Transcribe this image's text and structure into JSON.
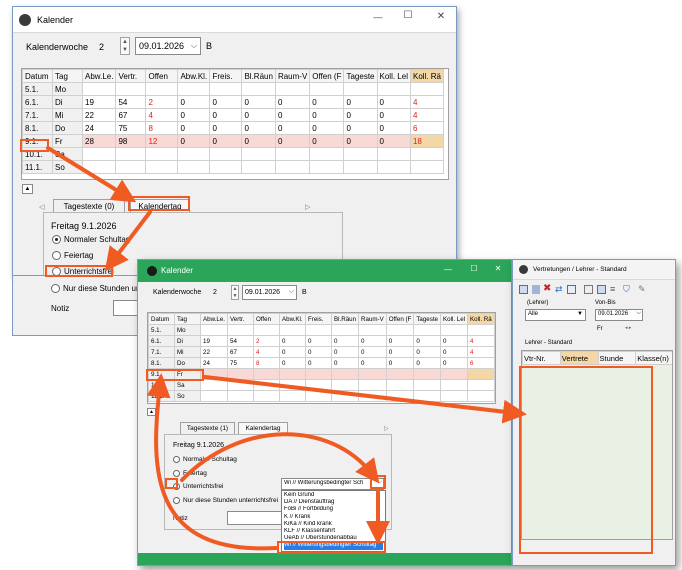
{
  "colors": {
    "accent": "#f05a23",
    "selection_row": "#f8d9d6",
    "koll_column": "#f3d7a6",
    "red_value": "#e02020",
    "list_selection": "#2a7ce0"
  },
  "window_back": {
    "title": "Kalender",
    "week_label": "Kalenderwoche",
    "week_number": "2",
    "date_value": "09.01.2026",
    "b_label": "B",
    "grid": {
      "columns": [
        "Datum",
        "Tag",
        "Abw.Le.",
        "Vertr.",
        "Offen",
        "Abw.Kl.",
        "Freis.",
        "Bl.Räun",
        "Raum-V",
        "Offen (F",
        "Tageste",
        "Koll. Lel",
        "Koll. Rä"
      ],
      "rows": [
        [
          "5.1.",
          "Mo",
          "",
          "",
          "",
          "",
          "",
          "",
          "",
          "",
          "",
          "",
          ""
        ],
        [
          "6.1.",
          "Di",
          "19",
          "54",
          "2",
          "0",
          "0",
          "0",
          "0",
          "0",
          "0",
          "0",
          "4"
        ],
        [
          "7.1.",
          "Mi",
          "22",
          "67",
          "4",
          "0",
          "0",
          "0",
          "0",
          "0",
          "0",
          "0",
          "4"
        ],
        [
          "8.1.",
          "Do",
          "24",
          "75",
          "8",
          "0",
          "0",
          "0",
          "0",
          "0",
          "0",
          "0",
          "6"
        ],
        [
          "9.1.",
          "Fr",
          "28",
          "98",
          "12",
          "0",
          "0",
          "0",
          "0",
          "0",
          "0",
          "0",
          "18"
        ],
        [
          "10.1.",
          "Sa",
          "",
          "",
          "",
          "",
          "",
          "",
          "",
          "",
          "",
          "",
          ""
        ],
        [
          "11.1.",
          "So",
          "",
          "",
          "",
          "",
          "",
          "",
          "",
          "",
          "",
          "",
          ""
        ]
      ]
    },
    "tab_tagestexte": "Tagestexte (0)",
    "tab_kalendertag": "Kalendertag",
    "day_heading": "Freitag 9.1.2026",
    "radio_normal": "Normaler Schultag",
    "radio_feiertag": "Feiertag",
    "radio_unterrichtsfrei": "Unterrichtsfrei",
    "radio_nur_stunden": "Nur diese Stunden unt",
    "notiz_label": "Notiz",
    "collapse_glyph": "▲"
  },
  "window_front": {
    "title": "Kalender",
    "week_label": "Kalenderwoche",
    "week_number": "2",
    "date_value": "09.01.2026",
    "b_label": "B",
    "grid": {
      "columns": [
        "Datum",
        "Tag",
        "Abw.Le.",
        "Vertr.",
        "Offen",
        "Abw.Kl.",
        "Freis.",
        "Bl.Räun",
        "Raum-V",
        "Offen (F",
        "Tageste",
        "Koll. Lel",
        "Koll. Rä"
      ],
      "rows": [
        [
          "5.1.",
          "Mo",
          "",
          "",
          "",
          "",
          "",
          "",
          "",
          "",
          "",
          "",
          ""
        ],
        [
          "6.1.",
          "Di",
          "19",
          "54",
          "2",
          "0",
          "0",
          "0",
          "0",
          "0",
          "0",
          "0",
          "4"
        ],
        [
          "7.1.",
          "Mi",
          "22",
          "67",
          "4",
          "0",
          "0",
          "0",
          "0",
          "0",
          "0",
          "0",
          "4"
        ],
        [
          "8.1.",
          "Do",
          "24",
          "75",
          "8",
          "0",
          "0",
          "0",
          "0",
          "0",
          "0",
          "0",
          "6"
        ],
        [
          "9.1.",
          "Fr",
          "",
          "",
          "",
          "",
          "",
          "",
          "",
          "",
          "",
          "",
          ""
        ],
        [
          "10.1.",
          "Sa",
          "",
          "",
          "",
          "",
          "",
          "",
          "",
          "",
          "",
          "",
          ""
        ],
        [
          "11.1.",
          "So",
          "",
          "",
          "",
          "",
          "",
          "",
          "",
          "",
          "",
          "",
          ""
        ]
      ]
    },
    "tab_tagestexte": "Tagestexte (1)",
    "tab_kalendertag": "Kalendertag",
    "day_heading": "Freitag 9.1.2026",
    "radio_normal": "Normaler Schultag",
    "radio_feiertag": "Feiertag",
    "radio_unterrichtsfrei": "Unterrichtsfrei",
    "radio_nur_stunden": "Nur diese Stunden unterrichtsfrei",
    "notiz_label": "Notiz",
    "reason_value": "Wi // Witterungsbedingter Sch",
    "reason_options": [
      "Kein Grund",
      "DA // Dienstauftrag",
      "FoBi // Fortbildung",
      "K // Krank",
      "KiKa // Kind krank",
      "KLF // Klassenfahrt",
      "UeAb // Überstundenabbau",
      "Wi // Witterungsbedingter Schultag"
    ],
    "collapse_glyph": "▲"
  },
  "side_panel": {
    "title": "Vertretungen / Lehrer - Standard",
    "lehrer_label": "(Lehrer)",
    "lehrer_value": "Alle",
    "von_bis_label": "Von-Bis",
    "von_bis_value": "09.01.2026",
    "fr_label": "Fr",
    "section_label": "Lehrer - Standard",
    "columns": [
      "Vtr-Nr.",
      "Vertrete",
      "Stunde",
      "Klasse(n)"
    ]
  },
  "window_controls": {
    "minimize": "—",
    "maximize": "☐",
    "close": "✕"
  }
}
